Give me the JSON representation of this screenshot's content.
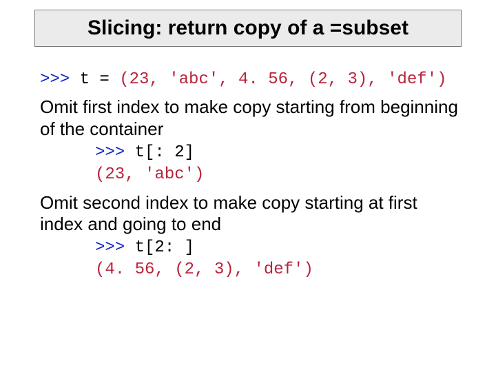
{
  "title": "Slicing: return copy of a =subset",
  "line1": {
    "prompt": ">>> ",
    "assign": "t = ",
    "tuple": "(23, 'abc', 4. 56, (2, 3), 'def')"
  },
  "para1": "Omit first index to make copy starting from beginning of the container",
  "ex1": {
    "call_prompt": ">>> ",
    "call_code": "t[: 2]",
    "result": "(23, 'abc')"
  },
  "para2": "Omit second index to make copy starting at first index and going to end",
  "ex2": {
    "call_prompt": ">>> ",
    "call_code": "t[2: ]",
    "result": "(4. 56, (2, 3), 'def')"
  }
}
